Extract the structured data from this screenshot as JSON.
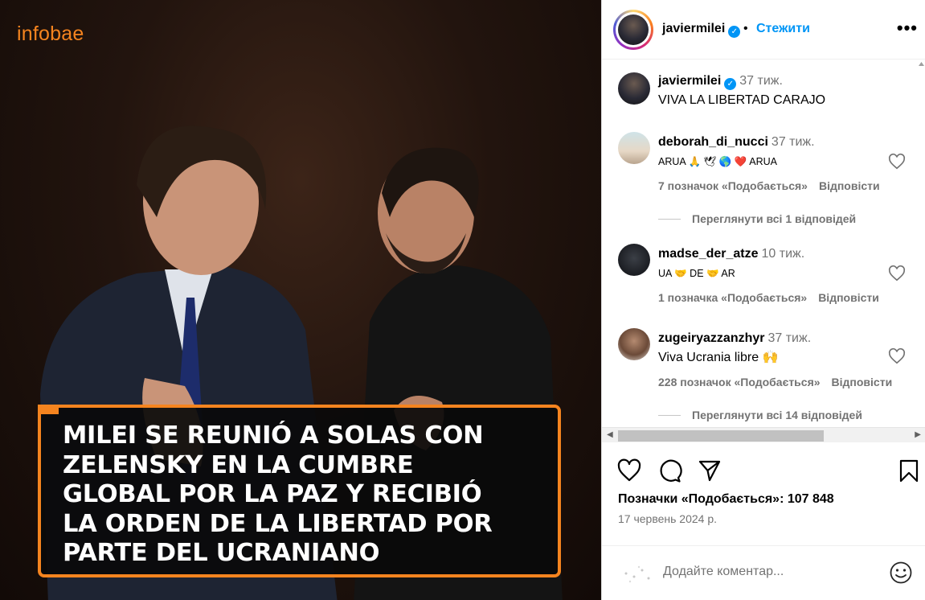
{
  "media": {
    "logo": "infobae",
    "headline": "MILEI SE REUNIÓ A SOLAS CON\nZELENSKY EN LA CUMBRE\nGLOBAL POR LA PAZ Y RECIBIÓ\nLA ORDEN DE LA LIBERTAD POR\nPARTE DEL UCRANIANO"
  },
  "header": {
    "username": "javiermilei",
    "separator": "•",
    "follow_label": "Стежити",
    "more_label": "•••"
  },
  "caption": {
    "username": "javiermilei",
    "time": "37 тиж.",
    "text": "VIVA LA LIBERTAD CARAJO"
  },
  "comments": [
    {
      "username": "deborah_di_nucci",
      "time": "37 тиж.",
      "text": "ARUA 🙏 🕊 🌎 ❤️ ARUA",
      "likes": "7 позначок «Подобається»",
      "reply_label": "Відповісти",
      "view_replies": "Переглянути всі 1 відповідей"
    },
    {
      "username": "madse_der_atze",
      "time": "10 тиж.",
      "text": "UA 🤝 DE 🤝 AR",
      "likes": "1 позначка «Подобається»",
      "reply_label": "Відповісти"
    },
    {
      "username": "zugeiryazzanzhyr",
      "time": "37 тиж.",
      "text": "Viva Ucrania libre 🙌",
      "likes": "228 позначок «Подобається»",
      "reply_label": "Відповісти",
      "view_replies": "Переглянути всі 14 відповідей"
    }
  ],
  "actions": {
    "like_icon": "heart-icon",
    "comment_icon": "comment-icon",
    "share_icon": "share-icon",
    "save_icon": "bookmark-icon"
  },
  "likes_text": "Позначки «Подобається»: 107 848",
  "date": "17 червень 2024 р.",
  "add_comment_placeholder": "Додайте коментар...",
  "colors": {
    "accent": "#0095f6",
    "brand_orange": "#f5841f",
    "muted": "#737373"
  }
}
